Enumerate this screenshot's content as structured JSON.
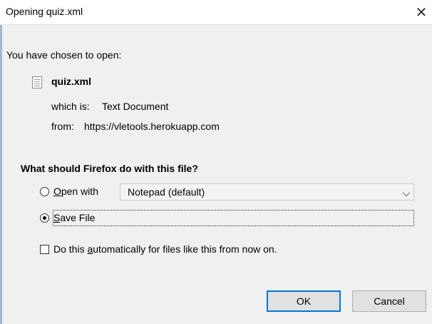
{
  "window": {
    "title": "Opening quiz.xml",
    "close_glyph": "✕"
  },
  "dialog": {
    "intro": "You have chosen to open:",
    "file_name": "quiz.xml",
    "which_is_label": "which is:",
    "which_is_value": "Text Document",
    "from_label": "from:",
    "from_value": "https://vletools.herokuapp.com",
    "question": "What should Firefox do with this file?"
  },
  "options": {
    "open_with": {
      "label_prefix": "",
      "label_accel": "O",
      "label_rest": "pen with",
      "selected": false,
      "app_selected": "Notepad (default)"
    },
    "save_file": {
      "label_accel": "S",
      "label_rest": "ave File",
      "selected": true
    },
    "auto": {
      "label_before": "Do this ",
      "label_accel": "a",
      "label_rest": "utomatically for files like this from now on.",
      "checked": false
    }
  },
  "buttons": {
    "ok": "OK",
    "cancel": "Cancel"
  },
  "colors": {
    "accent": "#0078d7",
    "background": "#f0f0f0"
  },
  "icons": {
    "file": "text-file-icon",
    "dropdown": "chevron-down-icon",
    "close": "close-icon"
  }
}
